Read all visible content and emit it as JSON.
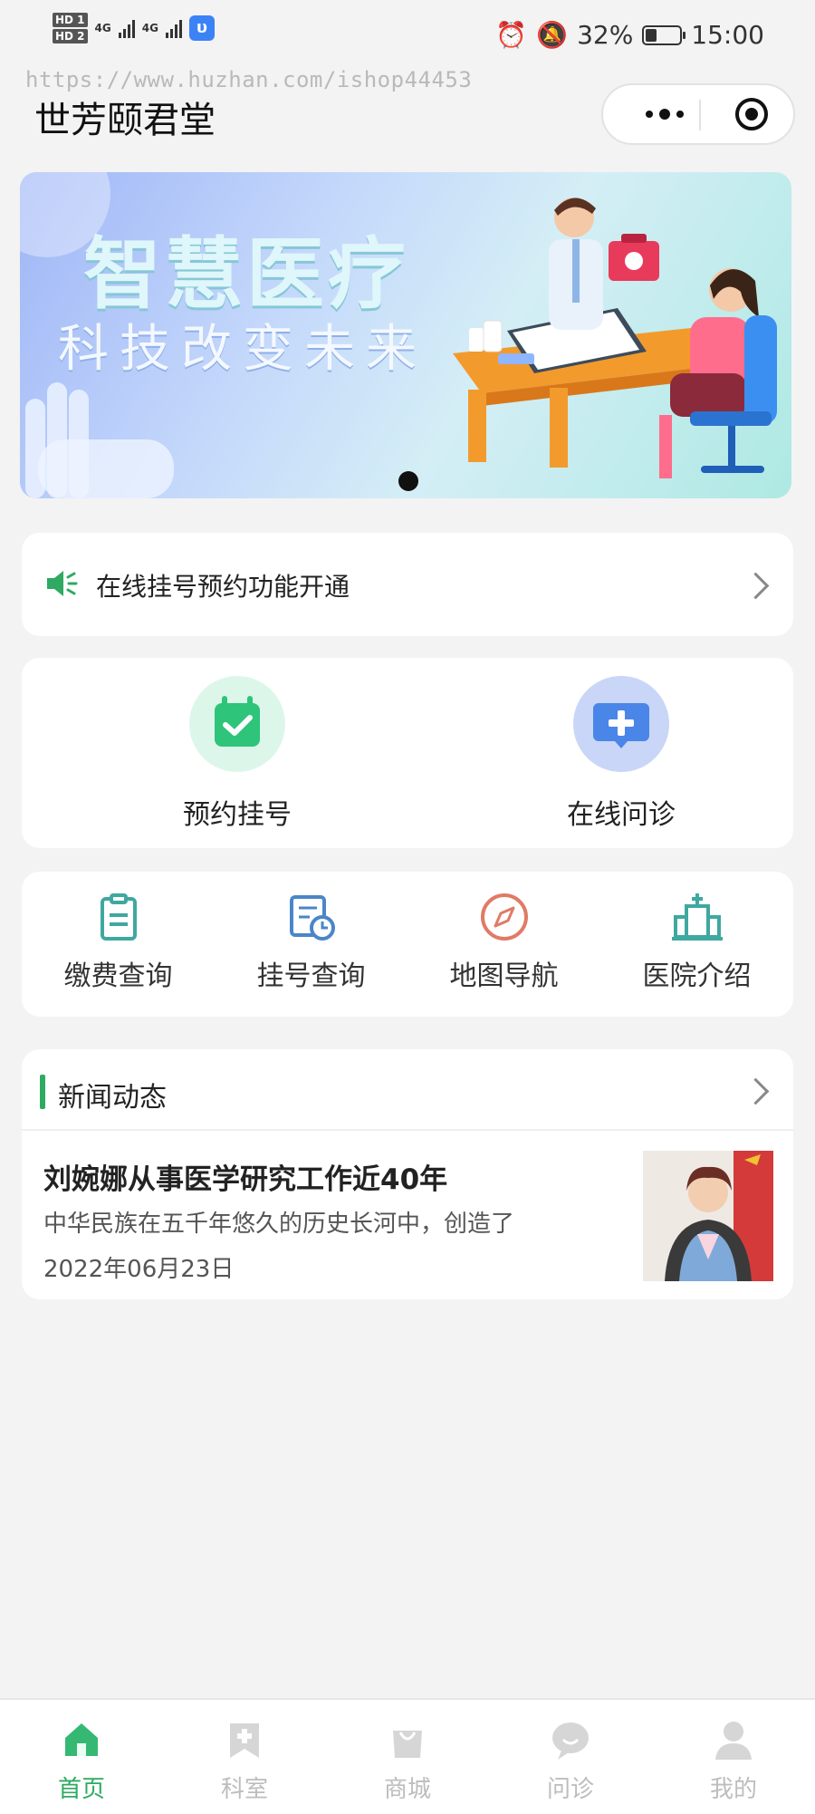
{
  "status_bar": {
    "sim1": "HD 1",
    "sim2": "HD 2",
    "network1": "4G",
    "network2": "4G",
    "battery_percent": "32%",
    "battery_level": 0.32,
    "time": "15:00"
  },
  "watermark": "https://www.huzhan.com/ishop44453",
  "header": {
    "title": "世芳颐君堂"
  },
  "banner": {
    "line1": "智慧医疗",
    "line2": "科技改变未来"
  },
  "notice": {
    "text": "在线挂号预约功能开通"
  },
  "services": [
    {
      "label": "预约挂号",
      "icon": "calendar-check-icon"
    },
    {
      "label": "在线问诊",
      "icon": "chat-plus-icon"
    }
  ],
  "quick_links": [
    {
      "label": "缴费查询",
      "icon": "clipboard-icon"
    },
    {
      "label": "挂号查询",
      "icon": "schedule-icon"
    },
    {
      "label": "地图导航",
      "icon": "compass-icon"
    },
    {
      "label": "医院介绍",
      "icon": "hospital-icon"
    }
  ],
  "news": {
    "section_title": "新闻动态",
    "items": [
      {
        "title": "刘婉娜从事医学研究工作近40年",
        "summary": "中华民族在五千年悠久的历史长河中，创造了",
        "date": "2022年06月23日"
      }
    ]
  },
  "tabbar": [
    {
      "label": "首页",
      "icon": "home-icon",
      "active": true
    },
    {
      "label": "科室",
      "icon": "department-icon",
      "active": false
    },
    {
      "label": "商城",
      "icon": "shop-bag-icon",
      "active": false
    },
    {
      "label": "问诊",
      "icon": "consult-icon",
      "active": false
    },
    {
      "label": "我的",
      "icon": "user-icon",
      "active": false
    }
  ],
  "colors": {
    "accent": "#2eaa62",
    "background": "#f3f3f3"
  }
}
